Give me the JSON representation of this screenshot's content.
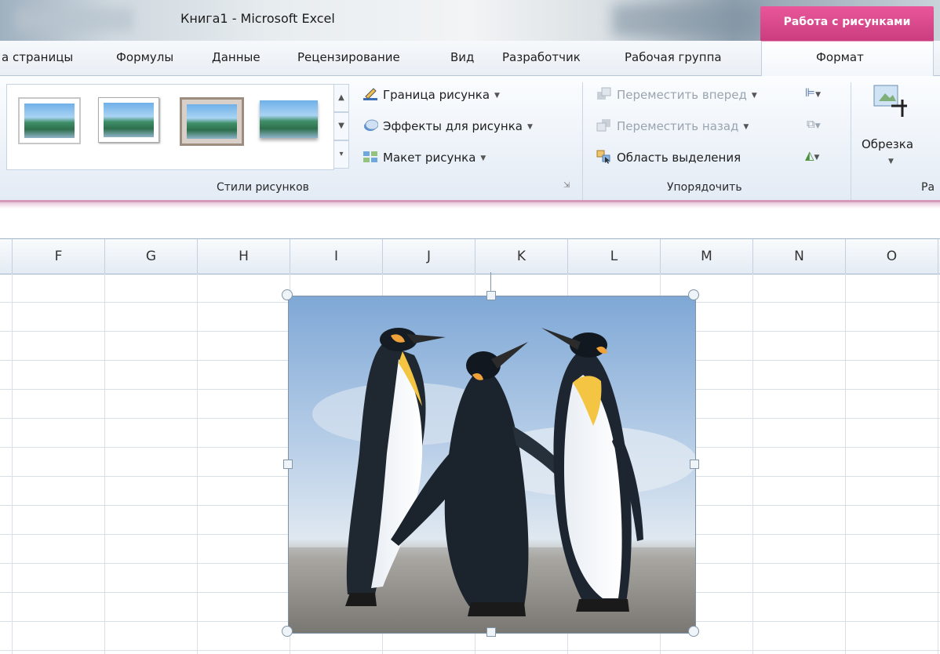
{
  "window": {
    "title": "Книга1  -  Microsoft Excel",
    "context_tab_header": "Работа с рисунками"
  },
  "tabs": [
    "а страницы",
    "Формулы",
    "Данные",
    "Рецензирование",
    "Вид",
    "Разработчик",
    "Рабочая группа"
  ],
  "active_tab": "Формат",
  "ribbon": {
    "styles_group": {
      "label": "Стили рисунков",
      "border_label": "Граница рисунка",
      "effects_label": "Эффекты для рисунка",
      "layout_label": "Макет рисунка"
    },
    "arrange_group": {
      "label": "Упорядочить",
      "bring_forward": "Переместить вперед",
      "send_backward": "Переместить назад",
      "selection_pane": "Область выделения"
    },
    "size_group": {
      "crop_label": "Обрезка",
      "label_partial": "Ра"
    }
  },
  "columns": [
    "F",
    "G",
    "H",
    "I",
    "J",
    "K",
    "L",
    "M",
    "N",
    "O"
  ],
  "colors": {
    "context_tab": "#d94a8c",
    "ribbon_bg": "#eef3f9",
    "grid_line": "#d9dfe6"
  },
  "picture": {
    "subject": "penguins-photo"
  }
}
